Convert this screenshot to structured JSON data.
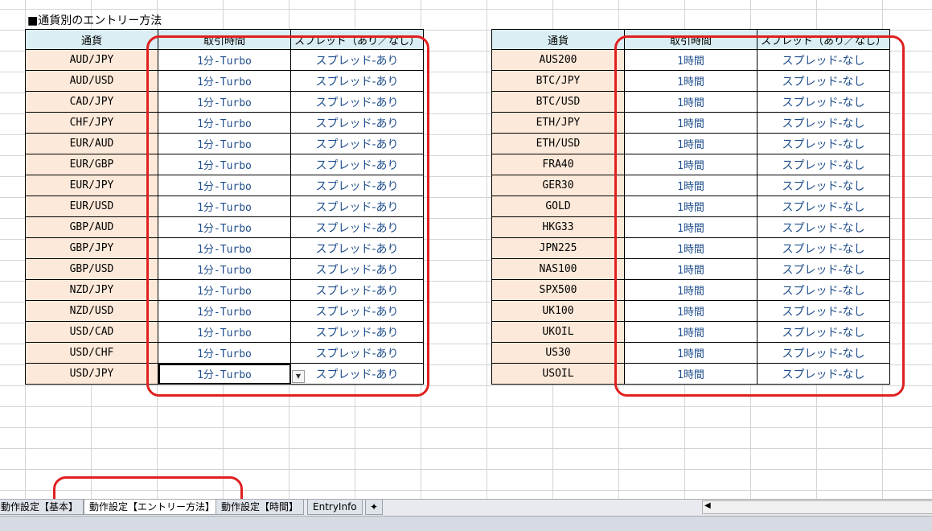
{
  "sheet_title": "■通貨別のエントリー方法",
  "left_table": {
    "headers": [
      "通貨",
      "取引時間",
      "スプレッド（あり／なし）"
    ],
    "rows": [
      [
        "AUD/JPY",
        "1分-Turbo",
        "スプレッド-あり"
      ],
      [
        "AUD/USD",
        "1分-Turbo",
        "スプレッド-あり"
      ],
      [
        "CAD/JPY",
        "1分-Turbo",
        "スプレッド-あり"
      ],
      [
        "CHF/JPY",
        "1分-Turbo",
        "スプレッド-あり"
      ],
      [
        "EUR/AUD",
        "1分-Turbo",
        "スプレッド-あり"
      ],
      [
        "EUR/GBP",
        "1分-Turbo",
        "スプレッド-あり"
      ],
      [
        "EUR/JPY",
        "1分-Turbo",
        "スプレッド-あり"
      ],
      [
        "EUR/USD",
        "1分-Turbo",
        "スプレッド-あり"
      ],
      [
        "GBP/AUD",
        "1分-Turbo",
        "スプレッド-あり"
      ],
      [
        "GBP/JPY",
        "1分-Turbo",
        "スプレッド-あり"
      ],
      [
        "GBP/USD",
        "1分-Turbo",
        "スプレッド-あり"
      ],
      [
        "NZD/JPY",
        "1分-Turbo",
        "スプレッド-あり"
      ],
      [
        "NZD/USD",
        "1分-Turbo",
        "スプレッド-あり"
      ],
      [
        "USD/CAD",
        "1分-Turbo",
        "スプレッド-あり"
      ],
      [
        "USD/CHF",
        "1分-Turbo",
        "スプレッド-あり"
      ],
      [
        "USD/JPY",
        "1分-Turbo",
        "スプレッド-あり"
      ]
    ]
  },
  "right_table": {
    "headers": [
      "通貨",
      "取引時間",
      "スプレッド（あり／なし）"
    ],
    "rows": [
      [
        "AUS200",
        "1時間",
        "スプレッド-なし"
      ],
      [
        "BTC/JPY",
        "1時間",
        "スプレッド-なし"
      ],
      [
        "BTC/USD",
        "1時間",
        "スプレッド-なし"
      ],
      [
        "ETH/JPY",
        "1時間",
        "スプレッド-なし"
      ],
      [
        "ETH/USD",
        "1時間",
        "スプレッド-なし"
      ],
      [
        "FRA40",
        "1時間",
        "スプレッド-なし"
      ],
      [
        "GER30",
        "1時間",
        "スプレッド-なし"
      ],
      [
        "GOLD",
        "1時間",
        "スプレッド-なし"
      ],
      [
        "HKG33",
        "1時間",
        "スプレッド-なし"
      ],
      [
        "JPN225",
        "1時間",
        "スプレッド-なし"
      ],
      [
        "NAS100",
        "1時間",
        "スプレッド-なし"
      ],
      [
        "SPX500",
        "1時間",
        "スプレッド-なし"
      ],
      [
        "UK100",
        "1時間",
        "スプレッド-なし"
      ],
      [
        "UKOIL",
        "1時間",
        "スプレッド-なし"
      ],
      [
        "US30",
        "1時間",
        "スプレッド-なし"
      ],
      [
        "USOIL",
        "1時間",
        "スプレッド-なし"
      ]
    ]
  },
  "sheet_tabs": [
    {
      "label": "動作設定【基本】",
      "active": false
    },
    {
      "label": "動作設定【エントリー方法】",
      "active": true
    },
    {
      "label": "動作設定【時間】",
      "active": false
    },
    {
      "label": "EntryInfo",
      "active": false
    }
  ],
  "colors": {
    "header_bg": "#daeef3",
    "currency_bg": "#fde9d9",
    "value_text": "#1f4e8c",
    "highlight_frame": "#e02020"
  },
  "icons": {
    "dropdown": "dropdown-arrow-icon",
    "new_sheet": "insert-sheet-icon",
    "scroll_left": "scroll-left-icon"
  }
}
